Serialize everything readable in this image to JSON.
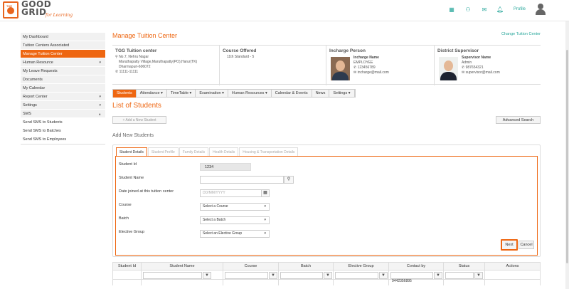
{
  "brand": {
    "the": "THE",
    "name_line1": "GOOD",
    "name_line2": "GRID",
    "tagline": "for Learning"
  },
  "topbar": {
    "profile_label": "Profile",
    "icons": [
      "apps-icon",
      "users-icon",
      "mail-icon",
      "bell-icon"
    ]
  },
  "sidebar": {
    "items": [
      {
        "label": "My Dashboard"
      },
      {
        "label": "Tuition Centers Associated"
      },
      {
        "label": "Manage Tuition Center",
        "active": true
      },
      {
        "label": "Human Resource",
        "arrow": "▾"
      },
      {
        "label": "My Leave Requests"
      },
      {
        "label": "Documents"
      },
      {
        "label": "My Calendar"
      },
      {
        "label": "Report Center",
        "arrow": "▾"
      },
      {
        "label": "Settings",
        "arrow": "▾"
      },
      {
        "label": "SMS",
        "arrow": "▾"
      }
    ],
    "sms_sub": [
      "Send SMS to Students",
      "Send SMS to Batches",
      "Send SMS to Employees"
    ]
  },
  "page": {
    "title": "Manage Tuition Center",
    "change_link": "Change Tuition Center"
  },
  "center": {
    "name": "TGG Tuition center",
    "address1": "No.7, Nehru Nagar",
    "address2": "Maruthapatty Village,Maruthapatty(PO),Harur(TK)",
    "address3": "Dharmapuri-606072",
    "phone": "11111-11111"
  },
  "course_offered": {
    "heading": "Course Offered",
    "value": "11th Standard - 5"
  },
  "incharge": {
    "heading": "Incharge Person",
    "name": "Incharge Name",
    "role": "EMPLOYEE",
    "phone": "123456789",
    "email": "incharge@mail.com"
  },
  "supervisor": {
    "heading": "District Supervisor",
    "name": "Supervisor Name",
    "role": "Admin",
    "phone": "987654321",
    "email": "supervisor@mail.com"
  },
  "module_tabs": [
    {
      "label": "Students",
      "active": true
    },
    {
      "label": "Attendance ▾"
    },
    {
      "label": "TimeTable ▾"
    },
    {
      "label": "Examination ▾"
    },
    {
      "label": "Human Resources ▾"
    },
    {
      "label": "Calendar & Events"
    },
    {
      "label": "News"
    },
    {
      "label": "Settings ▾"
    }
  ],
  "students": {
    "title": "List of Students",
    "add_button": "+ Add a New Student",
    "advanced_search": "Advanced Search",
    "add_new_title": "Add New Students"
  },
  "form_tabs": [
    {
      "label": "Student Details",
      "active": true
    },
    {
      "label": "Student Profile"
    },
    {
      "label": "Family Details"
    },
    {
      "label": "Health Details"
    },
    {
      "label": "Housing & Transportation Details"
    }
  ],
  "form": {
    "student_id_label": "Student Id",
    "student_id_value": "1234",
    "student_name_label": "Student Name",
    "student_name_value": "",
    "date_label": "Date joined at this tuition center",
    "date_placeholder": "DD/MM/YYYY",
    "course_label": "Course",
    "course_value": "Select a Course",
    "batch_label": "Batch",
    "batch_value": "Select a Batch",
    "elective_label": "Elective Group",
    "elective_value": "Select an Elective Group",
    "next": "Next",
    "cancel": "Cancel"
  },
  "table": {
    "headers": [
      "Student Id",
      "Student Name",
      "Course",
      "Batch",
      "Elective Group",
      "Contact by",
      "Status",
      "Actions"
    ],
    "first_contact": "9442356895"
  }
}
